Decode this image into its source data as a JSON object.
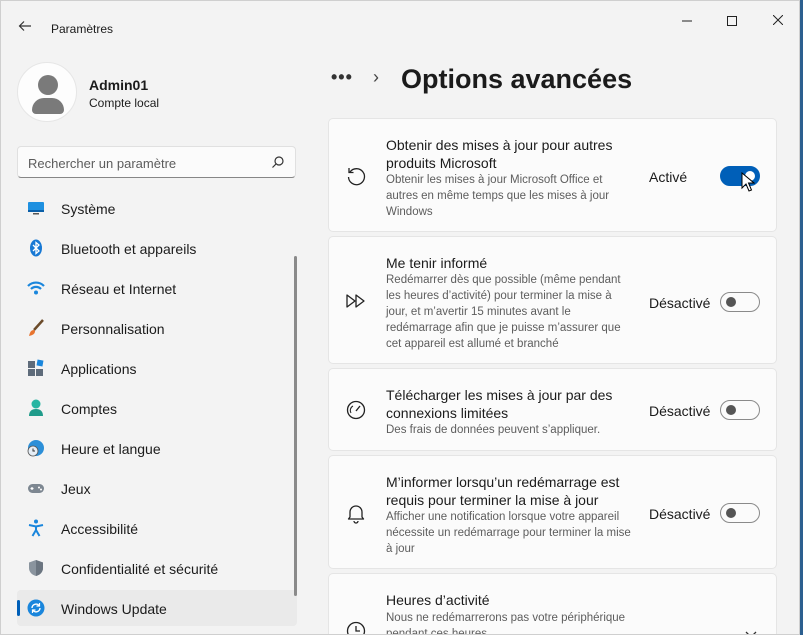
{
  "window": {
    "title": "Paramètres",
    "controls": {
      "minimize": "—",
      "maximize": "☐",
      "close": "✕"
    }
  },
  "user": {
    "name": "Admin01",
    "account_type": "Compte local"
  },
  "search": {
    "placeholder": "Rechercher un paramètre"
  },
  "nav": {
    "items": [
      {
        "label": "Système",
        "icon": "system-icon"
      },
      {
        "label": "Bluetooth et appareils",
        "icon": "bluetooth-icon"
      },
      {
        "label": "Réseau et Internet",
        "icon": "wifi-icon"
      },
      {
        "label": "Personnalisation",
        "icon": "brush-icon"
      },
      {
        "label": "Applications",
        "icon": "apps-icon"
      },
      {
        "label": "Comptes",
        "icon": "account-icon"
      },
      {
        "label": "Heure et langue",
        "icon": "globe-clock-icon"
      },
      {
        "label": "Jeux",
        "icon": "gamepad-icon"
      },
      {
        "label": "Accessibilité",
        "icon": "accessibility-icon"
      },
      {
        "label": "Confidentialité et sécurité",
        "icon": "shield-icon"
      },
      {
        "label": "Windows Update",
        "icon": "windows-update-icon",
        "selected": true
      }
    ]
  },
  "header": {
    "breadcrumb_more": "•••",
    "separator": "›",
    "title": "Options avancées"
  },
  "cards": [
    {
      "title": "Obtenir des mises à jour pour autres produits Microsoft",
      "description": "Obtenir les mises à jour Microsoft Office et autres en même temps que les mises à jour Windows",
      "status": "Activé",
      "on": true,
      "icon": "refresh-icon"
    },
    {
      "title": "Me tenir informé",
      "description": "Redémarrer dès que possible (même pendant les heures d’activité) pour terminer la mise à jour, et m’avertir 15 minutes avant le redémarrage afin que je puisse m’assurer que cet appareil est allumé et branché",
      "status": "Désactivé",
      "on": false,
      "icon": "fast-forward-icon"
    },
    {
      "title": "Télécharger les mises à jour par des connexions limitées",
      "description": "Des frais de données peuvent s’appliquer.",
      "status": "Désactivé",
      "on": false,
      "icon": "gauge-icon"
    },
    {
      "title": "M’informer lorsqu’un redémarrage est requis pour terminer la mise à jour",
      "description": "Afficher une notification lorsque votre appareil nécessite un redémarrage pour terminer la mise à jour",
      "status": "Désactivé",
      "on": false,
      "icon": "bell-icon"
    },
    {
      "title": "Heures d’activité",
      "description": "Nous ne redémarrerons pas votre périphérique pendant ces heures",
      "icon": "clock-icon"
    }
  ],
  "colors": {
    "accent": "#005fb8",
    "window_bg": "#f3f3f3",
    "card_bg": "#fbfbfb"
  }
}
